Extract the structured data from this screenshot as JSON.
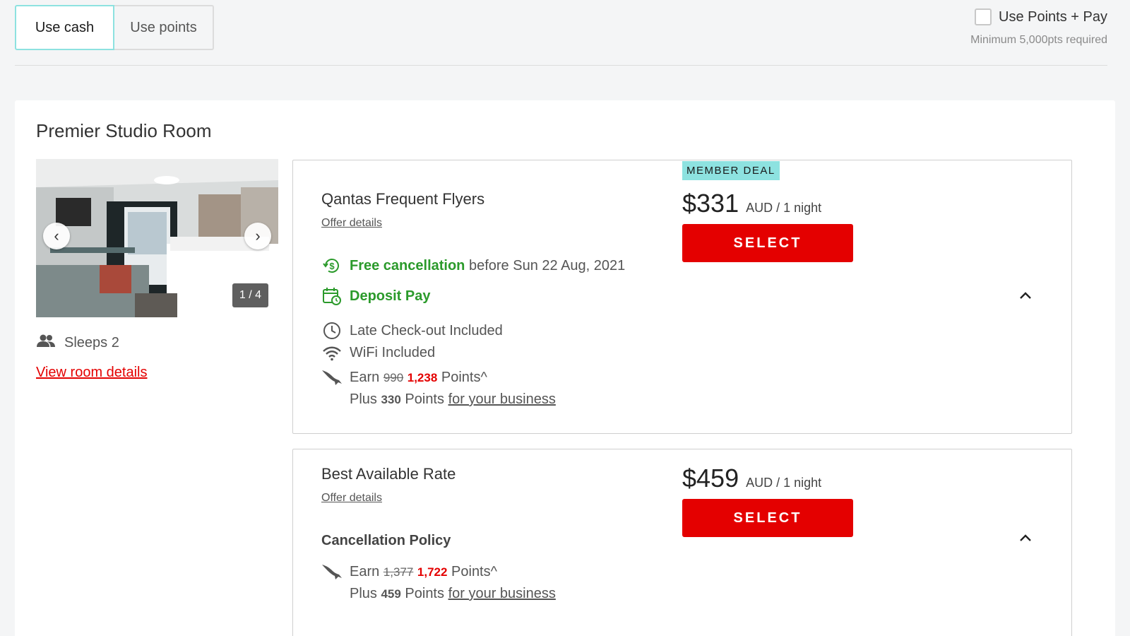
{
  "payment_toggle": {
    "cash_label": "Use cash",
    "points_label": "Use points"
  },
  "points_pay": {
    "label": "Use Points + Pay",
    "subtext": "Minimum 5,000pts required"
  },
  "room": {
    "title": "Premier Studio Room",
    "photo_counter": "1 / 4",
    "sleeps": "Sleeps 2",
    "view_details": "View room details"
  },
  "offers": [
    {
      "badge": "MEMBER DEAL",
      "name": "Qantas Frequent Flyers",
      "details_link": "Offer details",
      "price": "$331",
      "price_unit": "AUD / 1 night",
      "select_label": "SELECT",
      "free_cancel": "Free cancellation",
      "free_cancel_date": "before Sun 22 Aug, 2021",
      "deposit": "Deposit Pay",
      "late_checkout": "Late Check-out Included",
      "wifi": "WiFi Included",
      "earn_label": "Earn",
      "earn_old": "990",
      "earn_new": "1,238",
      "earn_suffix": "Points^",
      "plus_label": "Plus",
      "plus_points": "330",
      "plus_suffix": "Points",
      "business_link": "for your business"
    },
    {
      "name": "Best Available Rate",
      "details_link": "Offer details",
      "price": "$459",
      "price_unit": "AUD / 1 night",
      "select_label": "SELECT",
      "policy": "Cancellation Policy",
      "earn_label": "Earn",
      "earn_old": "1,377",
      "earn_new": "1,722",
      "earn_suffix": "Points^",
      "plus_label": "Plus",
      "plus_points": "459",
      "plus_suffix": "Points",
      "business_link": "for your business"
    }
  ]
}
